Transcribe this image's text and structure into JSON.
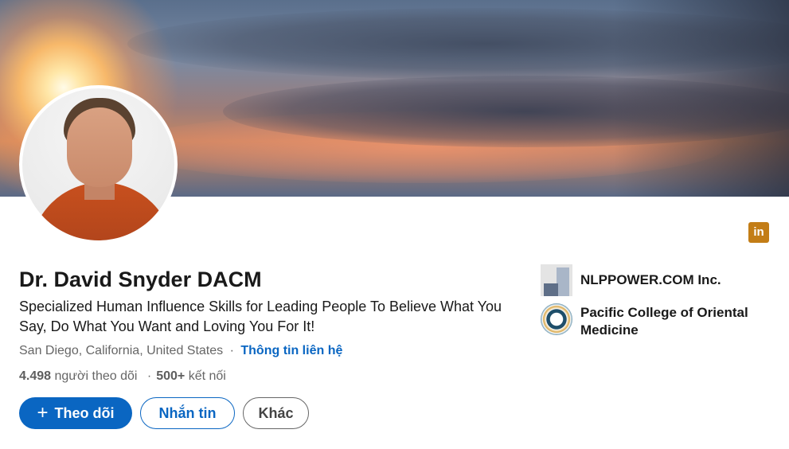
{
  "profile": {
    "name": "Dr. David Snyder DACM",
    "headline": "Specialized Human Influence Skills for Leading People To Believe What You Say, Do What You Want and Loving You For It!",
    "location": "San Diego, California, United States",
    "separator": "·",
    "contact_info_label": "Thông tin liên hệ",
    "followers_count": "4.498",
    "followers_label": "người theo dõi",
    "connections_count": "500+",
    "connections_label": "kết nối"
  },
  "actions": {
    "follow_icon": "+",
    "follow_label": "Theo dõi",
    "message_label": "Nhắn tin",
    "more_label": "Khác"
  },
  "organizations": [
    {
      "name": "NLPPOWER.COM Inc.",
      "icon": "company-logo-icon"
    },
    {
      "name": "Pacific College of Oriental Medicine",
      "icon": "school-logo-icon"
    }
  ],
  "brand_badge": {
    "text": "in",
    "icon": "linkedin-icon",
    "color": "#c37d16"
  },
  "colors": {
    "accent": "#0a66c2",
    "secondary_text": "#666666",
    "primary_text": "#191919"
  }
}
